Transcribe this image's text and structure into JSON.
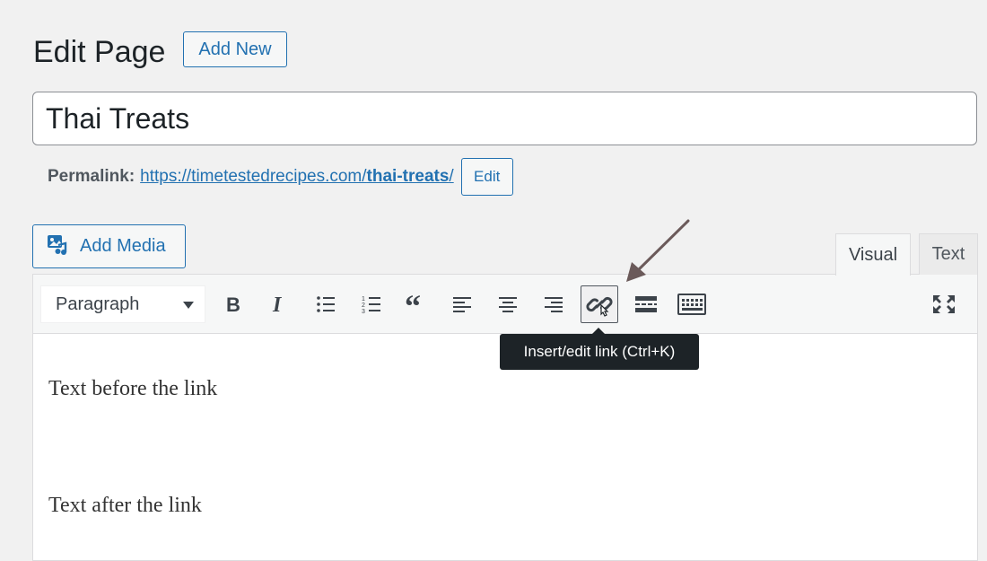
{
  "header": {
    "title": "Edit Page",
    "add_new_label": "Add New"
  },
  "title_field": {
    "value": "Thai Treats"
  },
  "permalink": {
    "label": "Permalink:",
    "url_base": "https://timetestedrecipes.com/",
    "slug": "thai-treats",
    "url_trail": "/",
    "edit_label": "Edit"
  },
  "media": {
    "add_media_label": "Add Media"
  },
  "editor_tabs": [
    {
      "label": "Visual",
      "active": true
    },
    {
      "label": "Text",
      "active": false
    }
  ],
  "toolbar": {
    "format_select": "Paragraph",
    "buttons": [
      {
        "icon": "bold-icon"
      },
      {
        "icon": "italic-icon"
      },
      {
        "icon": "bulleted-list-icon"
      },
      {
        "icon": "numbered-list-icon"
      },
      {
        "icon": "blockquote-icon"
      },
      {
        "icon": "align-left-icon"
      },
      {
        "icon": "align-center-icon"
      },
      {
        "icon": "align-right-icon"
      },
      {
        "icon": "link-icon"
      },
      {
        "icon": "read-more-icon"
      },
      {
        "icon": "toolbar-toggle-icon"
      },
      {
        "icon": "fullscreen-icon"
      }
    ],
    "tooltip": "Insert/edit link (Ctrl+K)"
  },
  "content": {
    "paragraphs": [
      "Text before the link",
      "Text after the link"
    ]
  },
  "colors": {
    "accent": "#2271b1",
    "tooltip_bg": "#1d2327",
    "annotation_arrow": "#6b5a5a"
  }
}
